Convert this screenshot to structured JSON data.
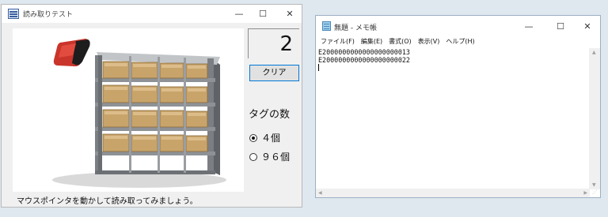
{
  "left_window": {
    "title": "読み取りテスト",
    "counter_value": "2",
    "clear_button": "クリア",
    "tag_count_label": "タグの数",
    "radio_options": [
      {
        "label": "４個",
        "selected": true
      },
      {
        "label": "９６個",
        "selected": false
      }
    ],
    "status_text": "マウスポインタを動かして読み取ってみましょう。"
  },
  "notepad": {
    "title": "無題 - メモ帳",
    "menu": [
      "ファイル(F)",
      "編集(E)",
      "書式(O)",
      "表示(V)",
      "ヘルプ(H)"
    ],
    "lines": [
      "E2000000000000000000013",
      "E2000000000000000000022"
    ]
  },
  "window_controls": {
    "minimize": "—",
    "maximize": "☐",
    "close": "✕"
  }
}
